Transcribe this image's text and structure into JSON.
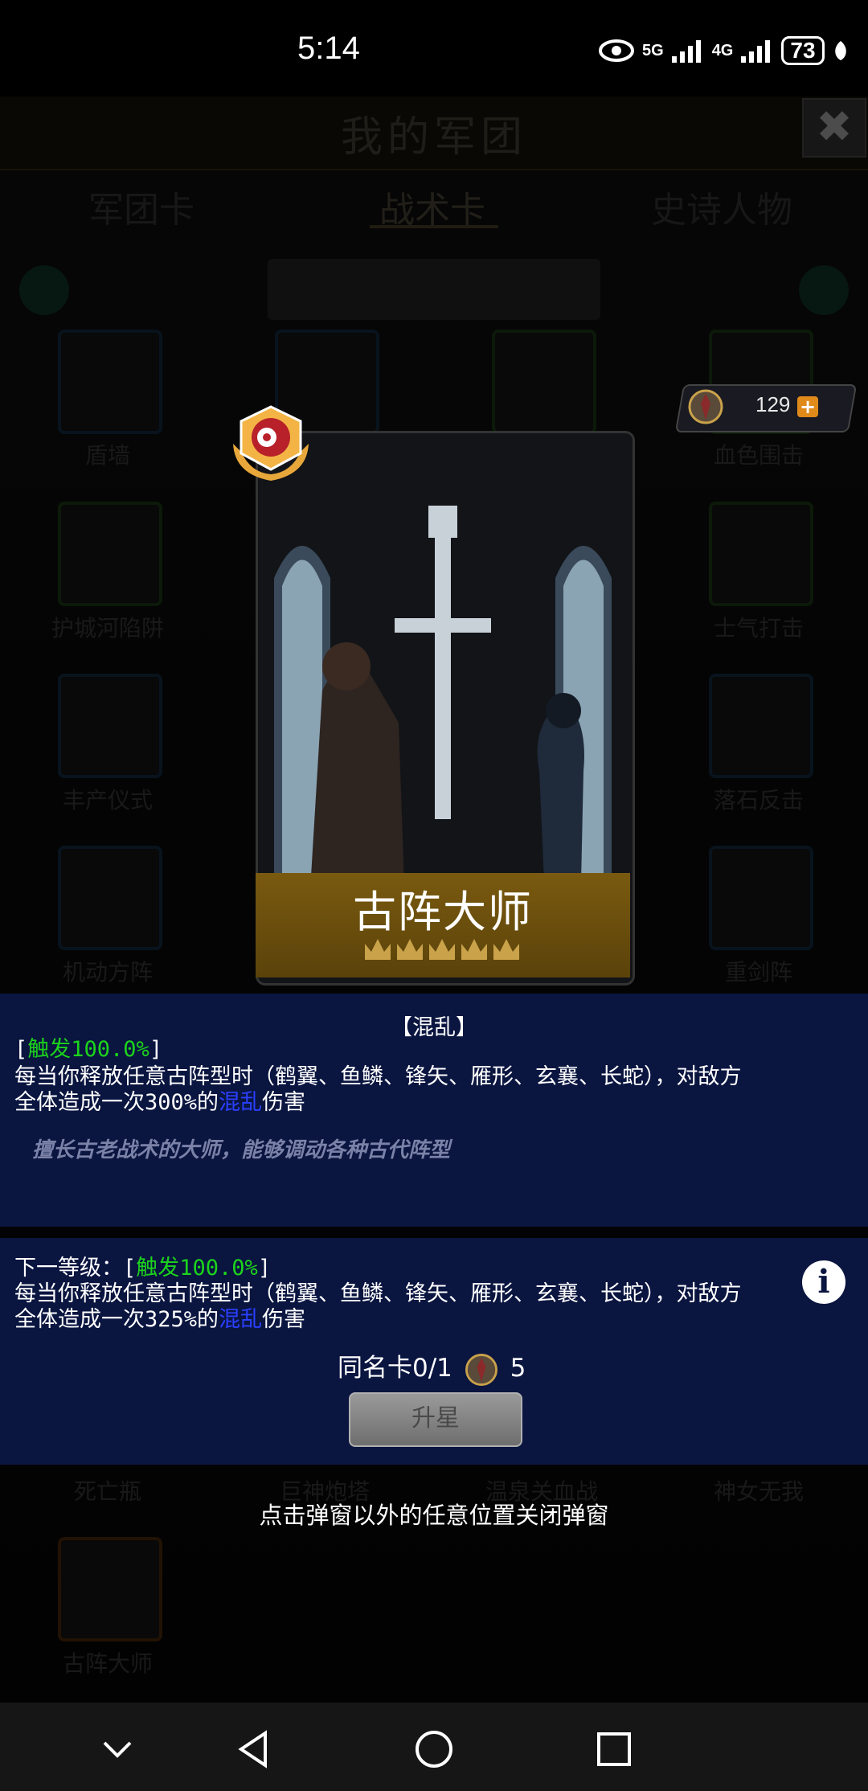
{
  "status_bar": {
    "time": "5:14",
    "network1": "5G",
    "network2": "4G",
    "battery": "73"
  },
  "header": {
    "title": "我的军团",
    "close": "✖"
  },
  "tabs": [
    {
      "label": "军团卡",
      "active": false
    },
    {
      "label": "战术卡",
      "active": true
    },
    {
      "label": "史诗人物",
      "active": false
    }
  ],
  "grid_labels": {
    "r1c1": "盾墙",
    "r1c4": "血色围击",
    "r2c1": "护城河陷阱",
    "r2c4": "士气打击",
    "r3c1": "丰产仪式",
    "r3c4": "落石反击",
    "r4c1": "机动方阵",
    "r4c4": "重剑阵",
    "r7c1": "死亡瓶",
    "r7c2": "巨神炮塔",
    "r7c3": "温泉关血战",
    "r7c4": "神女无我",
    "r8c1": "古阵大师"
  },
  "currency": {
    "amount": "129",
    "plus": "+"
  },
  "card": {
    "name": "古阵大师"
  },
  "description": {
    "tag": "【混乱】",
    "current_prefix": "[",
    "current_trigger": "触发100.0%",
    "current_suffix": "]",
    "current_line1": "每当你释放任意古阵型时（鹤翼、鱼鳞、锋矢、雁形、玄襄、长蛇），对敌方",
    "current_line2_a": "全体造成一次300%的",
    "current_line2_b": "混乱",
    "current_line2_c": "伤害",
    "lore": "擅长古老战术的大师，能够调动各种古代阵型",
    "next_prefix": "下一等级：[",
    "next_trigger": "触发100.0%",
    "next_suffix": "]",
    "next_line1": "每当你释放任意古阵型时（鹤翼、鱼鳞、锋矢、雁形、玄襄、长蛇），对敌方",
    "next_line2_a": "全体造成一次325%的",
    "next_line2_b": "混乱",
    "next_line2_c": "伤害"
  },
  "duplicate": {
    "label": "同名卡0/1",
    "cost": "5"
  },
  "upgrade_button": "升星",
  "hint": "点击弹窗以外的任意位置关闭弹窗",
  "colors": {
    "trigger": "#1cd31c",
    "keyword": "#2a40ff",
    "panel": "#0a1540",
    "name_band": "#7a5a10"
  }
}
